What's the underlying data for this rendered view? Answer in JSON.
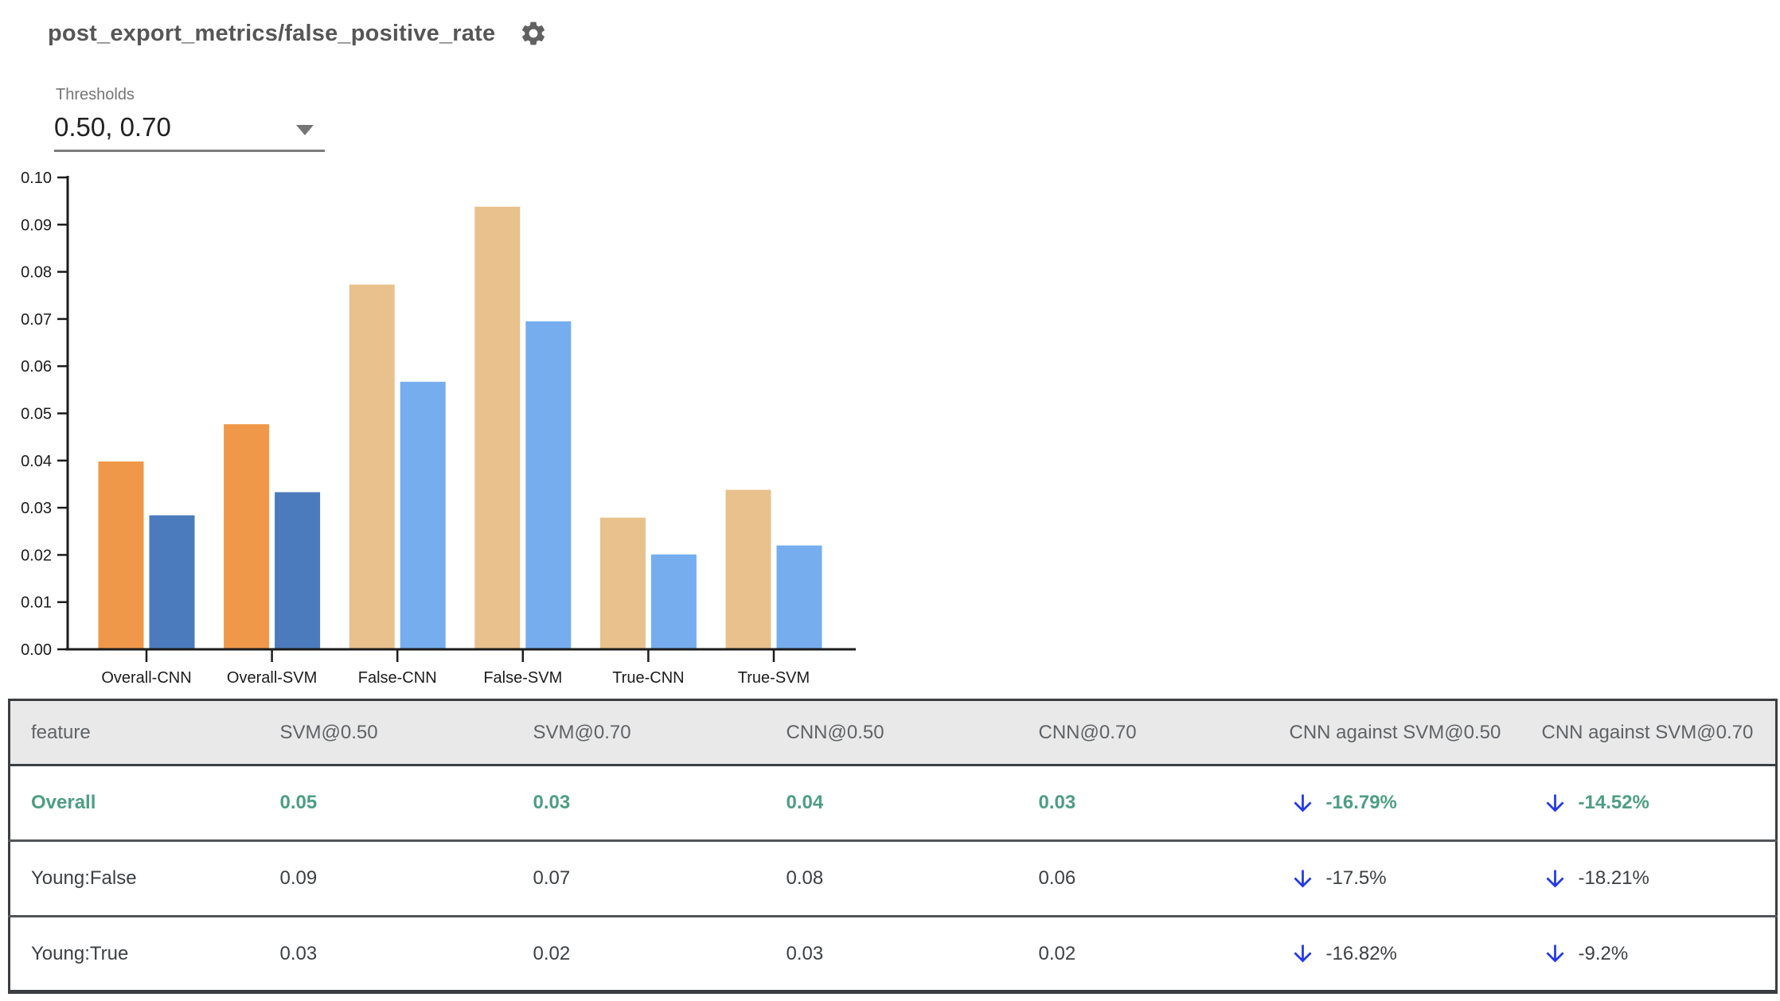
{
  "header": {
    "title": "post_export_metrics/false_positive_rate",
    "gear_icon": "settings-gear"
  },
  "thresholds": {
    "label": "Thresholds",
    "value": "0.50, 0.70"
  },
  "chart_data": {
    "type": "bar",
    "title": "",
    "xlabel": "",
    "ylabel": "",
    "categories": [
      "Overall-CNN",
      "Overall-SVM",
      "False-CNN",
      "False-SVM",
      "True-CNN",
      "True-SVM"
    ],
    "series": [
      {
        "name": "threshold-0.50",
        "values": [
          0.0398,
          0.0477,
          0.0773,
          0.0938,
          0.0279,
          0.0338
        ]
      },
      {
        "name": "threshold-0.70",
        "values": [
          0.0284,
          0.0333,
          0.0567,
          0.0695,
          0.0201,
          0.022
        ]
      }
    ],
    "ylim": [
      0,
      0.1
    ],
    "ytick_step": 0.01,
    "ytick_labels": [
      "0.00",
      "0.01",
      "0.02",
      "0.03",
      "0.04",
      "0.05",
      "0.06",
      "0.07",
      "0.08",
      "0.09",
      "0.10"
    ],
    "grid": false,
    "legend": "none",
    "highlight_groups": [
      0,
      1
    ],
    "colors": {
      "series0_highlight": "#F09849",
      "series1_highlight": "#4B7BBC",
      "series0_muted": "#E8C18C",
      "series1_muted": "#75ADEE",
      "axis": "#1c1c1c"
    }
  },
  "table": {
    "columns": [
      "feature",
      "SVM@0.50",
      "SVM@0.70",
      "CNN@0.50",
      "CNN@0.70",
      "CNN against SVM@0.50",
      "CNN against SVM@0.70"
    ],
    "arrow_icon": "down-arrow",
    "colors": {
      "highlight_text": "#4D9E82",
      "arrow_blue": "#2338E8",
      "header_bg": "#E9E9E9"
    },
    "rows": [
      {
        "feature": "Overall",
        "svm_050": "0.05",
        "svm_070": "0.03",
        "cnn_050": "0.04",
        "cnn_070": "0.03",
        "delta_050": "-16.79%",
        "delta_070": "-14.52%",
        "highlighted": true
      },
      {
        "feature": "Young:False",
        "svm_050": "0.09",
        "svm_070": "0.07",
        "cnn_050": "0.08",
        "cnn_070": "0.06",
        "delta_050": "-17.5%",
        "delta_070": "-18.21%",
        "highlighted": false
      },
      {
        "feature": "Young:True",
        "svm_050": "0.03",
        "svm_070": "0.02",
        "cnn_050": "0.03",
        "cnn_070": "0.02",
        "delta_050": "-16.82%",
        "delta_070": "-9.2%",
        "highlighted": false
      }
    ]
  }
}
